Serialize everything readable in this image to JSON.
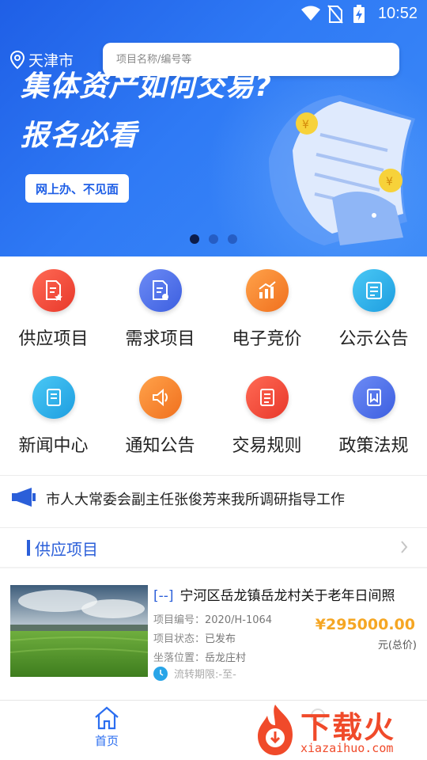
{
  "status_bar": {
    "time": "10:52"
  },
  "header": {
    "city": "天津市",
    "search_placeholder": "项目名称/编号等"
  },
  "banner": {
    "headline_line1": "集体资产如何交易?",
    "headline_line2": "报名必看",
    "button_label": "网上办、不见面",
    "slide_count": 3,
    "active_slide": 1
  },
  "grid": {
    "items": [
      {
        "label": "供应项目",
        "color": "#f04a3a"
      },
      {
        "label": "需求项目",
        "color": "#4a6fe8"
      },
      {
        "label": "电子竞价",
        "color": "#f78a2a"
      },
      {
        "label": "公示公告",
        "color": "#2ab3e8"
      },
      {
        "label": "新闻中心",
        "color": "#2ab3e8"
      },
      {
        "label": "通知公告",
        "color": "#f78a2a"
      },
      {
        "label": "交易规则",
        "color": "#f04a3a"
      },
      {
        "label": "政策法规",
        "color": "#4a6fe8"
      }
    ]
  },
  "notice": {
    "text": "市人大常委会副主任张俊芳来我所调研指导工作"
  },
  "section": {
    "title": "供应项目"
  },
  "project": {
    "prefix": "[--]",
    "title": "宁河区岳龙镇岳龙村关于老年日间照",
    "code_label": "项目编号：",
    "code": "2020/H-1064",
    "status_label": "项目状态：",
    "status": "已发布",
    "location_label": "坐落位置：",
    "location": "岳龙庄村",
    "period": "流转期限:-至-",
    "price": "¥295000.00",
    "price_unit": "元(总价)"
  },
  "bottom_nav": {
    "home_label": "首页"
  },
  "watermark": {
    "text": "下载火",
    "url": "xiazaihuo.com"
  }
}
